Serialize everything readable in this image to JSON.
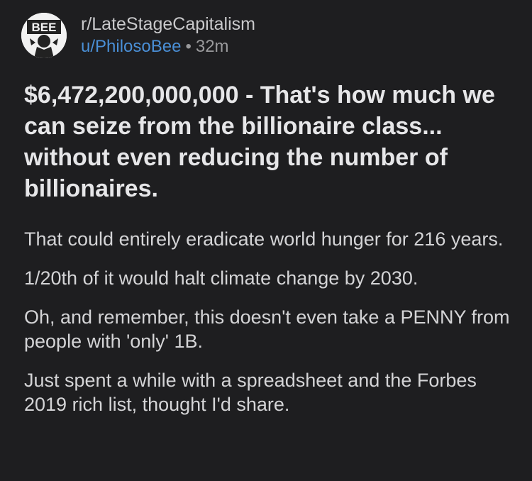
{
  "header": {
    "subreddit": "r/LateStageCapitalism",
    "username": "u/PhilosoBee",
    "separator": "•",
    "age": "32m",
    "avatar_icon": "bee-logo-icon"
  },
  "post": {
    "title": "$6,472,200,000,000 - That's how much we can seize from the billionaire class... without even reducing the number of billionaires.",
    "paragraphs": [
      "That could entirely eradicate world hunger for 216 years.",
      "1/20th of it would halt climate change by 2030.",
      "Oh, and remember, this doesn't even take a PENNY from people with 'only' 1B.",
      "Just spent a while with a spreadsheet and the Forbes 2019 rich list, thought I'd share."
    ]
  },
  "colors": {
    "background": "#1e1e20",
    "username": "#4a8fd6",
    "title": "#e6e6e8",
    "body_text": "#d4d4d6"
  }
}
